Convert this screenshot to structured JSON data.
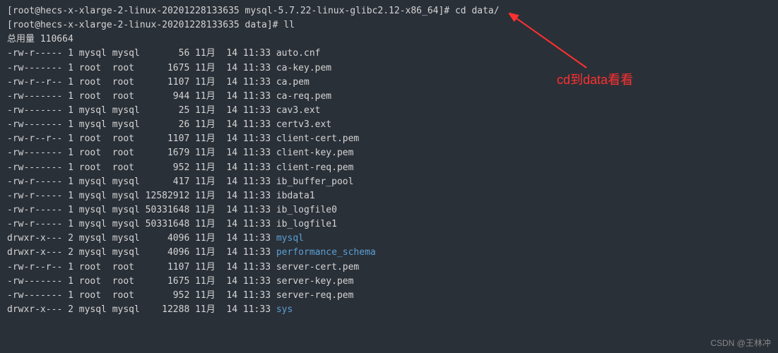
{
  "prompt1": {
    "user_host": "[root@hecs-x-xlarge-2-linux-20201228133635 mysql-5.7.22-linux-glibc2.12-x86_64]#",
    "cmd": "cd data/"
  },
  "prompt2": {
    "user_host": "[root@hecs-x-xlarge-2-linux-20201228133635 data]#",
    "cmd": "ll"
  },
  "total_line": "总用量 110664",
  "rows": [
    {
      "perm": "-rw-r-----",
      "links": "1",
      "owner": "mysql",
      "group": "mysql",
      "size": "56",
      "month": "11月",
      "day": "14",
      "time": "11:33",
      "name": "auto.cnf",
      "dir": false
    },
    {
      "perm": "-rw-------",
      "links": "1",
      "owner": "root",
      "group": "root",
      "size": "1675",
      "month": "11月",
      "day": "14",
      "time": "11:33",
      "name": "ca-key.pem",
      "dir": false
    },
    {
      "perm": "-rw-r--r--",
      "links": "1",
      "owner": "root",
      "group": "root",
      "size": "1107",
      "month": "11月",
      "day": "14",
      "time": "11:33",
      "name": "ca.pem",
      "dir": false
    },
    {
      "perm": "-rw-------",
      "links": "1",
      "owner": "root",
      "group": "root",
      "size": "944",
      "month": "11月",
      "day": "14",
      "time": "11:33",
      "name": "ca-req.pem",
      "dir": false
    },
    {
      "perm": "-rw-------",
      "links": "1",
      "owner": "mysql",
      "group": "mysql",
      "size": "25",
      "month": "11月",
      "day": "14",
      "time": "11:33",
      "name": "cav3.ext",
      "dir": false
    },
    {
      "perm": "-rw-------",
      "links": "1",
      "owner": "mysql",
      "group": "mysql",
      "size": "26",
      "month": "11月",
      "day": "14",
      "time": "11:33",
      "name": "certv3.ext",
      "dir": false
    },
    {
      "perm": "-rw-r--r--",
      "links": "1",
      "owner": "root",
      "group": "root",
      "size": "1107",
      "month": "11月",
      "day": "14",
      "time": "11:33",
      "name": "client-cert.pem",
      "dir": false
    },
    {
      "perm": "-rw-------",
      "links": "1",
      "owner": "root",
      "group": "root",
      "size": "1679",
      "month": "11月",
      "day": "14",
      "time": "11:33",
      "name": "client-key.pem",
      "dir": false
    },
    {
      "perm": "-rw-------",
      "links": "1",
      "owner": "root",
      "group": "root",
      "size": "952",
      "month": "11月",
      "day": "14",
      "time": "11:33",
      "name": "client-req.pem",
      "dir": false
    },
    {
      "perm": "-rw-r-----",
      "links": "1",
      "owner": "mysql",
      "group": "mysql",
      "size": "417",
      "month": "11月",
      "day": "14",
      "time": "11:33",
      "name": "ib_buffer_pool",
      "dir": false
    },
    {
      "perm": "-rw-r-----",
      "links": "1",
      "owner": "mysql",
      "group": "mysql",
      "size": "12582912",
      "month": "11月",
      "day": "14",
      "time": "11:33",
      "name": "ibdata1",
      "dir": false
    },
    {
      "perm": "-rw-r-----",
      "links": "1",
      "owner": "mysql",
      "group": "mysql",
      "size": "50331648",
      "month": "11月",
      "day": "14",
      "time": "11:33",
      "name": "ib_logfile0",
      "dir": false
    },
    {
      "perm": "-rw-r-----",
      "links": "1",
      "owner": "mysql",
      "group": "mysql",
      "size": "50331648",
      "month": "11月",
      "day": "14",
      "time": "11:33",
      "name": "ib_logfile1",
      "dir": false
    },
    {
      "perm": "drwxr-x---",
      "links": "2",
      "owner": "mysql",
      "group": "mysql",
      "size": "4096",
      "month": "11月",
      "day": "14",
      "time": "11:33",
      "name": "mysql",
      "dir": true
    },
    {
      "perm": "drwxr-x---",
      "links": "2",
      "owner": "mysql",
      "group": "mysql",
      "size": "4096",
      "month": "11月",
      "day": "14",
      "time": "11:33",
      "name": "performance_schema",
      "dir": true
    },
    {
      "perm": "-rw-r--r--",
      "links": "1",
      "owner": "root",
      "group": "root",
      "size": "1107",
      "month": "11月",
      "day": "14",
      "time": "11:33",
      "name": "server-cert.pem",
      "dir": false
    },
    {
      "perm": "-rw-------",
      "links": "1",
      "owner": "root",
      "group": "root",
      "size": "1675",
      "month": "11月",
      "day": "14",
      "time": "11:33",
      "name": "server-key.pem",
      "dir": false
    },
    {
      "perm": "-rw-------",
      "links": "1",
      "owner": "root",
      "group": "root",
      "size": "952",
      "month": "11月",
      "day": "14",
      "time": "11:33",
      "name": "server-req.pem",
      "dir": false
    },
    {
      "perm": "drwxr-x---",
      "links": "2",
      "owner": "mysql",
      "group": "mysql",
      "size": "12288",
      "month": "11月",
      "day": "14",
      "time": "11:33",
      "name": "sys",
      "dir": true
    }
  ],
  "annotation": "cd到data看看",
  "watermark": "CSDN @王林冲"
}
